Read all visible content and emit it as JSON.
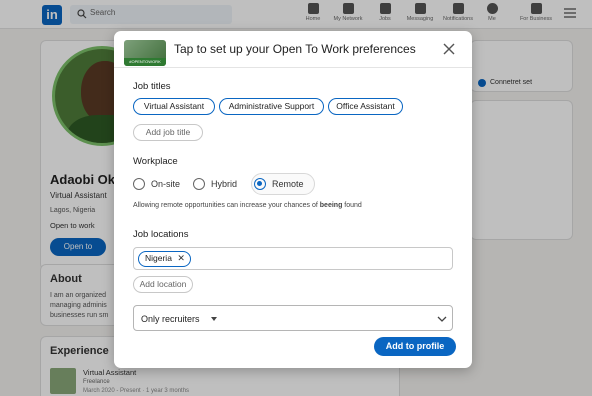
{
  "nav": {
    "search_placeholder": "Search",
    "items": [
      {
        "label": "Home"
      },
      {
        "label": "My Network"
      },
      {
        "label": "Jobs"
      },
      {
        "label": "Messaging"
      },
      {
        "label": "Notifications"
      },
      {
        "label": "Me"
      },
      {
        "label": "For Business"
      }
    ]
  },
  "profile": {
    "name": "Adaobi Ok",
    "headline": "Virtual Assistant",
    "location": "Lagos, Nigeria",
    "open_to_work": "Open to work",
    "open_to_button": "Open to",
    "about_title": "About",
    "about_lines": [
      "I am an organized",
      "managing adminis",
      "businesses run sm"
    ],
    "experience_title": "Experience",
    "exp_title": "Virtual Assistant",
    "exp_company": "Freelance",
    "exp_dates": "March 2020 - Present · 1 year 3 months"
  },
  "right": {
    "connect_label": "Connetret set"
  },
  "modal": {
    "title": "Tap to set up your Open To Work preferences",
    "thumb_badge": "#OPENTOWORK",
    "job_titles_heading": "Job titles",
    "job_titles": [
      "Virtual Assistant",
      "Administrative Support",
      "Office Assistant"
    ],
    "add_job_title": "Add job title",
    "workplace_heading": "Workplace",
    "workplace_options": [
      "On-site",
      "Hybrid",
      "Remote"
    ],
    "workplace_selected": "Remote",
    "remote_note_prefix": "Allowing remote opportunities can increase your chances of ",
    "remote_note_bold": "beeing",
    "remote_note_suffix": " found",
    "job_locations_heading": "Job locations",
    "location_chip": "Nigeria",
    "add_location": "Add location",
    "visibility_value": "Only recruiters",
    "submit_button": "Add to profile"
  },
  "colors": {
    "brand": "#0a66c2",
    "badge_green": "#2f7a32"
  }
}
